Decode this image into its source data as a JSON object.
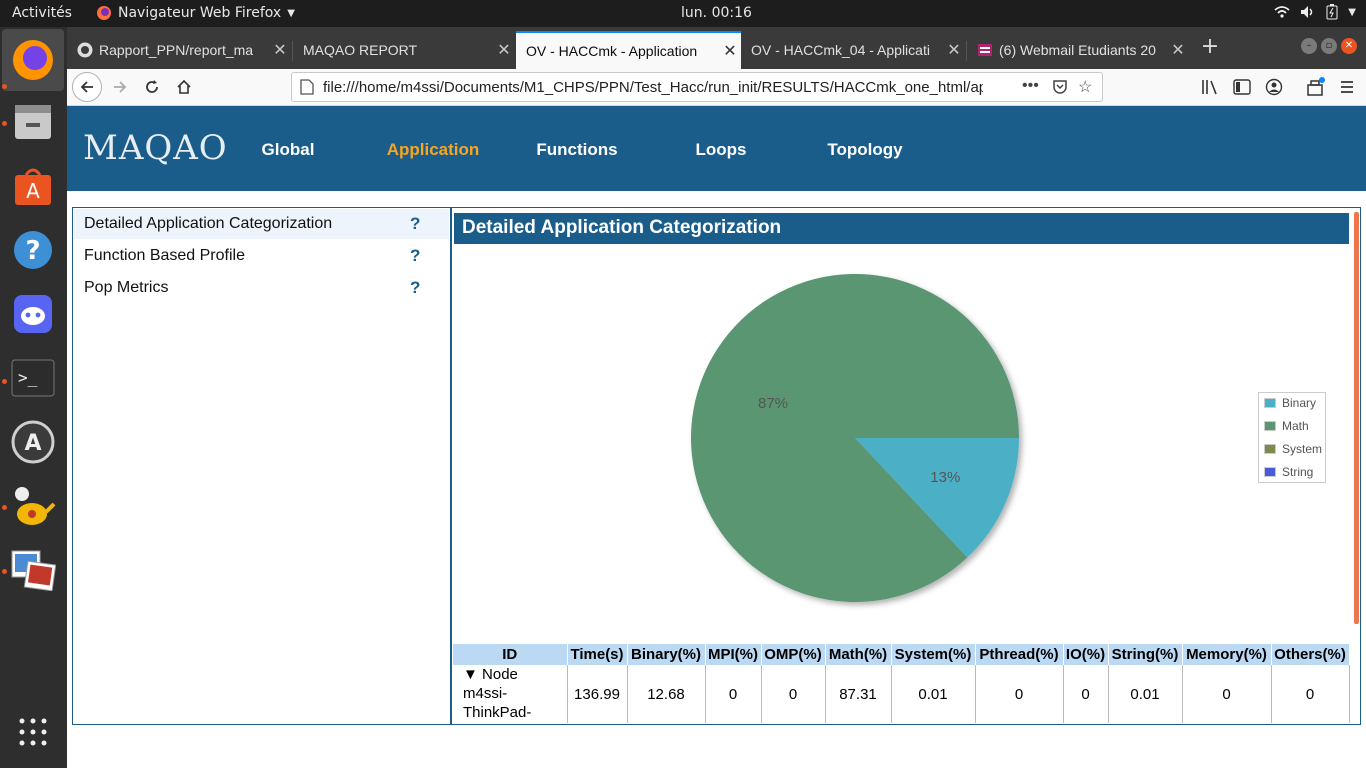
{
  "topbar": {
    "activities": "Activités",
    "app_name": "Navigateur Web Firefox",
    "clock": "lun. 00:16"
  },
  "browser": {
    "tabs": [
      {
        "label": "Rapport_PPN/report_ma",
        "active": false
      },
      {
        "label": "MAQAO REPORT",
        "active": false
      },
      {
        "label": "OV - HACCmk - Application",
        "active": true
      },
      {
        "label": "OV - HACCmk_04 - Applicati",
        "active": false
      },
      {
        "label": "(6) Webmail Etudiants 20",
        "active": false
      }
    ],
    "url": "file:///home/m4ssi/Documents/M1_CHPS/PPN/Test_Hacc/run_init/RESULTS/HACCmk_one_html/ap"
  },
  "maqao": {
    "logo": "MAQAO",
    "nav": [
      {
        "label": "Global",
        "selected": false
      },
      {
        "label": "Application",
        "selected": true
      },
      {
        "label": "Functions",
        "selected": false
      },
      {
        "label": "Loops",
        "selected": false
      },
      {
        "label": "Topology",
        "selected": false
      }
    ]
  },
  "menu": {
    "items": [
      {
        "label": "Detailed Application Categorization",
        "help": "?"
      },
      {
        "label": "Function Based Profile",
        "help": "?"
      },
      {
        "label": "Pop Metrics",
        "help": "?"
      }
    ]
  },
  "panel": {
    "title": "Detailed Application Categorization"
  },
  "chart_data": {
    "type": "pie",
    "series": [
      {
        "name": "Binary",
        "value": 13,
        "color": "#4bb0c6"
      },
      {
        "name": "Math",
        "value": 87,
        "color": "#5a9672"
      },
      {
        "name": "System",
        "value": 0,
        "color": "#7a8b4a"
      },
      {
        "name": "String",
        "value": 0,
        "color": "#4a5ad8"
      }
    ],
    "slice_labels": [
      "13%",
      "87%"
    ],
    "legend_position": "right"
  },
  "table": {
    "headers": [
      "ID",
      "Time(s)",
      "Binary(%)",
      "MPI(%)",
      "OMP(%)",
      "Math(%)",
      "System(%)",
      "Pthread(%)",
      "IO(%)",
      "String(%)",
      "Memory(%)",
      "Others(%)"
    ],
    "rows": [
      {
        "id_lines": [
          "▼ Node",
          "m4ssi-",
          "ThinkPad-"
        ],
        "values": [
          "136.99",
          "12.68",
          "0",
          "0",
          "87.31",
          "0.01",
          "0",
          "0",
          "0.01",
          "0",
          "0"
        ]
      }
    ]
  }
}
